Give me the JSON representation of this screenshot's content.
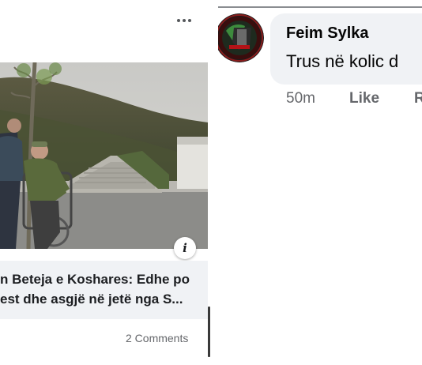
{
  "left_post": {
    "more_icon": "more-horizontal-icon",
    "info_icon_glyph": "i",
    "headline_line1": "n Beteja e Koshares: Edhe po",
    "headline_line2": "est dhe asgjë në jetë nga S...",
    "comments_count": "2 Comments",
    "colors": {
      "headline_box": "#f0f2f5",
      "text_secondary": "#65676b"
    }
  },
  "right_comment": {
    "author": "Feim Sylka",
    "text": "Trus në kolic d",
    "time": "50m",
    "like_label": "Like",
    "reply_label": "R",
    "avatar_icon": "organization-logo-icon",
    "colors": {
      "bubble": "#f0f2f5",
      "text_secondary": "#65676b"
    }
  }
}
